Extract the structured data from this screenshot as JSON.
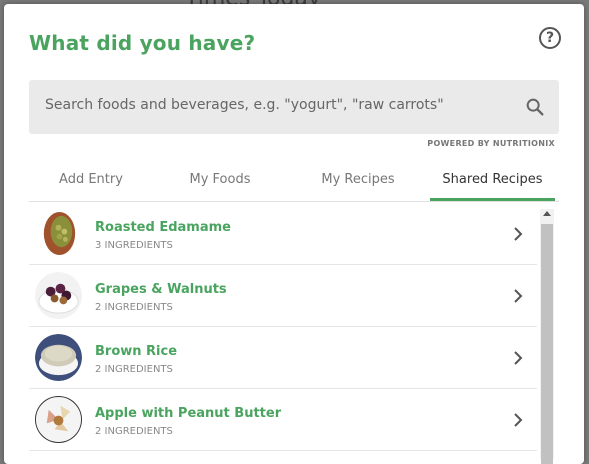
{
  "background": {
    "peek_text": "Times Today"
  },
  "modal": {
    "title": "What did you have?",
    "help_icon": "question-circle-icon",
    "search": {
      "placeholder": "Search foods and beverages, e.g. \"yogurt\", \"raw carrots\"",
      "value": "",
      "icon": "search-icon"
    },
    "powered_by": "POWERED BY NUTRITIONIX",
    "tabs": [
      {
        "label": "Add Entry",
        "active": false
      },
      {
        "label": "My Foods",
        "active": false
      },
      {
        "label": "My Recipes",
        "active": false
      },
      {
        "label": "Shared Recipes",
        "active": true
      }
    ],
    "recipes": [
      {
        "name": "Roasted Edamame",
        "ingredients": "3 INGREDIENTS",
        "image": "roasted-edamame-photo"
      },
      {
        "name": "Grapes & Walnuts",
        "ingredients": "2 INGREDIENTS",
        "image": "grapes-walnuts-photo"
      },
      {
        "name": "Brown Rice",
        "ingredients": "2 INGREDIENTS",
        "image": "brown-rice-photo"
      },
      {
        "name": "Apple with Peanut Butter",
        "ingredients": "2 INGREDIENTS",
        "image": "apple-peanut-butter-photo"
      }
    ]
  },
  "colors": {
    "accent": "#4aa45f",
    "search_bg": "#eaeaea",
    "overlay": "#7a7a7a"
  }
}
